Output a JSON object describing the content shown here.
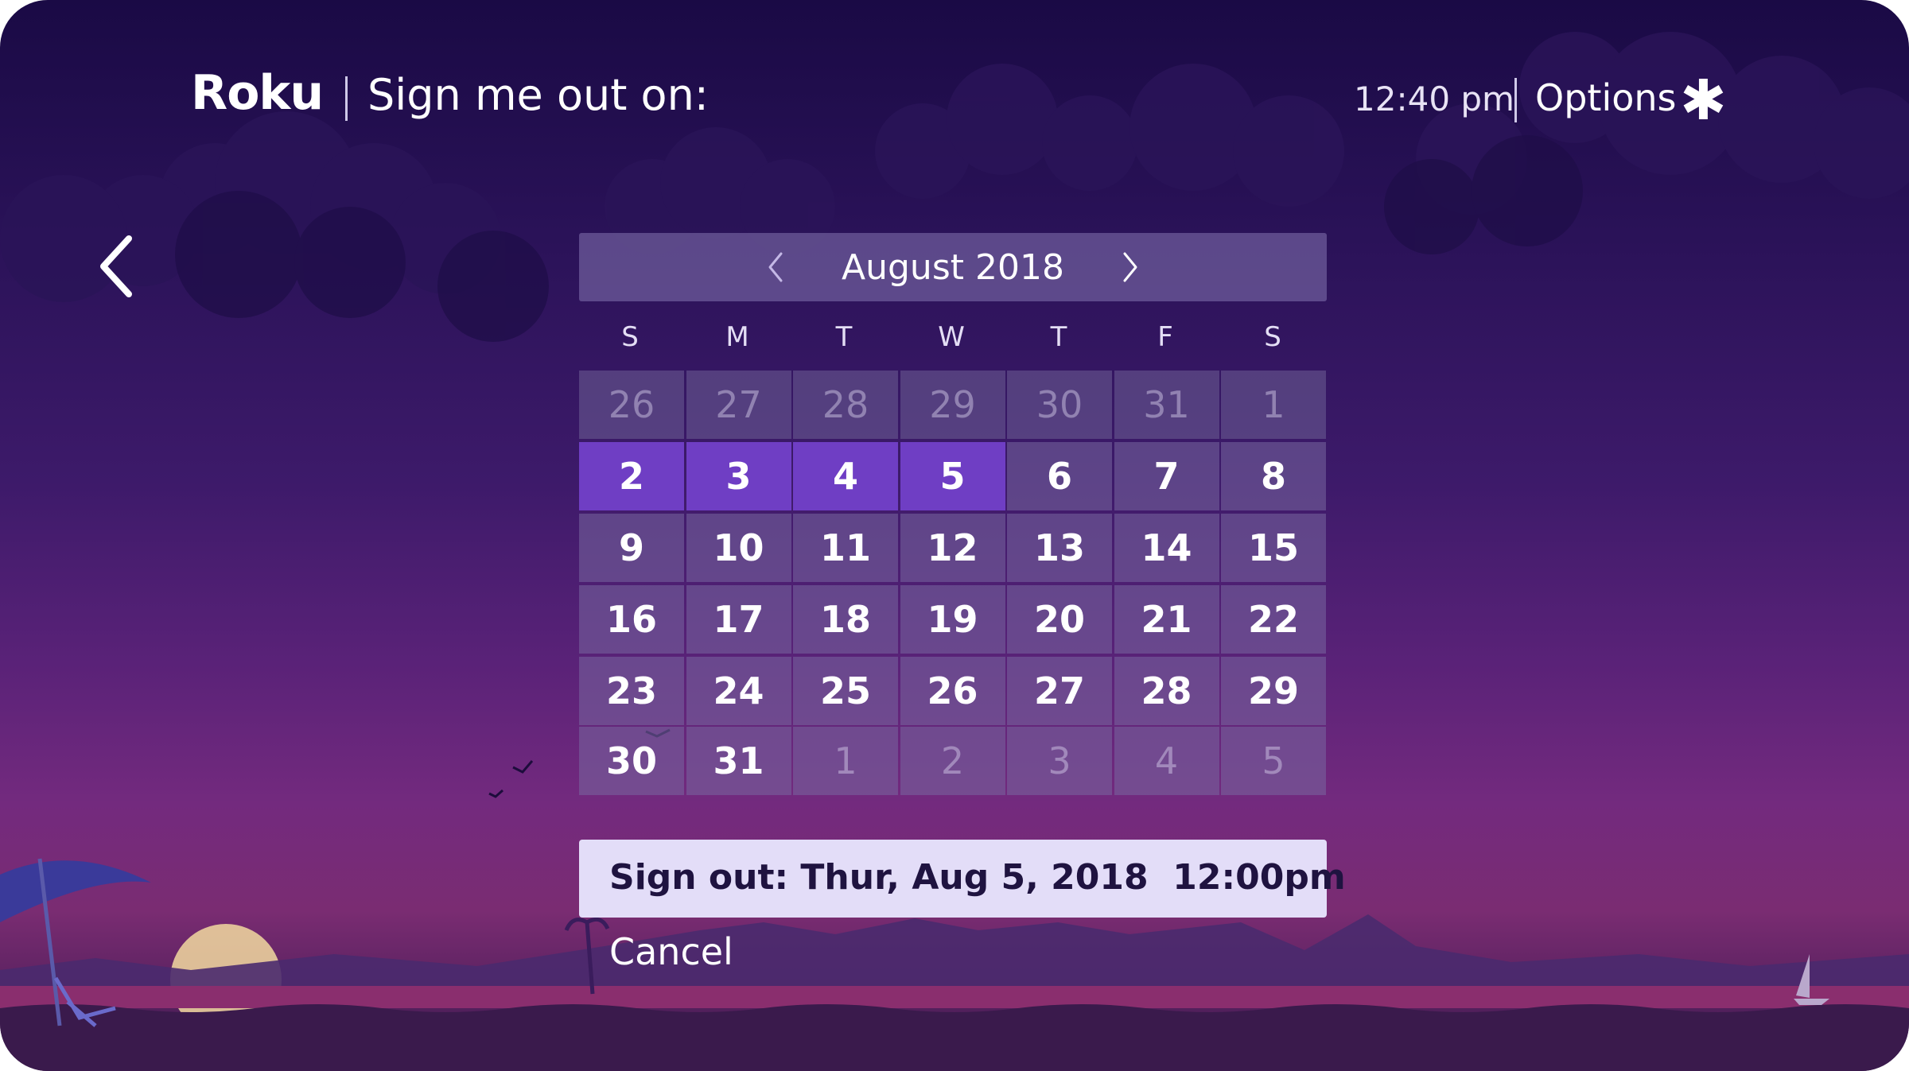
{
  "header": {
    "logo_text": "Roku",
    "title": "Sign me out on:",
    "time": "12:40 pm",
    "options_label": "Options",
    "options_icon": "star-icon"
  },
  "navigation": {
    "back_icon": "chevron-left-icon"
  },
  "calendar": {
    "month_label": "August 2018",
    "prev_icon": "chevron-left-icon",
    "next_icon": "chevron-right-icon",
    "weekdays": [
      "S",
      "M",
      "T",
      "W",
      "T",
      "F",
      "S"
    ],
    "weeks": [
      [
        {
          "day": "26",
          "in_month": false
        },
        {
          "day": "27",
          "in_month": false
        },
        {
          "day": "28",
          "in_month": false
        },
        {
          "day": "29",
          "in_month": false
        },
        {
          "day": "30",
          "in_month": false
        },
        {
          "day": "31",
          "in_month": false
        },
        {
          "day": "1",
          "in_month": false
        }
      ],
      [
        {
          "day": "2",
          "in_month": true,
          "selected": true
        },
        {
          "day": "3",
          "in_month": true,
          "selected": true
        },
        {
          "day": "4",
          "in_month": true,
          "selected": true
        },
        {
          "day": "5",
          "in_month": true,
          "selected": true
        },
        {
          "day": "6",
          "in_month": true
        },
        {
          "day": "7",
          "in_month": true
        },
        {
          "day": "8",
          "in_month": true
        }
      ],
      [
        {
          "day": "9",
          "in_month": true
        },
        {
          "day": "10",
          "in_month": true
        },
        {
          "day": "11",
          "in_month": true
        },
        {
          "day": "12",
          "in_month": true
        },
        {
          "day": "13",
          "in_month": true
        },
        {
          "day": "14",
          "in_month": true
        },
        {
          "day": "15",
          "in_month": true
        }
      ],
      [
        {
          "day": "16",
          "in_month": true
        },
        {
          "day": "17",
          "in_month": true
        },
        {
          "day": "18",
          "in_month": true
        },
        {
          "day": "19",
          "in_month": true
        },
        {
          "day": "20",
          "in_month": true
        },
        {
          "day": "21",
          "in_month": true
        },
        {
          "day": "22",
          "in_month": true
        }
      ],
      [
        {
          "day": "23",
          "in_month": true
        },
        {
          "day": "24",
          "in_month": true
        },
        {
          "day": "25",
          "in_month": true
        },
        {
          "day": "26",
          "in_month": true
        },
        {
          "day": "27",
          "in_month": true
        },
        {
          "day": "28",
          "in_month": true
        },
        {
          "day": "29",
          "in_month": true
        }
      ],
      [
        {
          "day": "30",
          "in_month": true
        },
        {
          "day": "31",
          "in_month": true
        },
        {
          "day": "1",
          "in_month": false
        },
        {
          "day": "2",
          "in_month": false
        },
        {
          "day": "3",
          "in_month": false
        },
        {
          "day": "4",
          "in_month": false
        },
        {
          "day": "5",
          "in_month": false
        }
      ]
    ]
  },
  "signout": {
    "label": "Sign out: Thur, Aug 5, 2018  12:00pm"
  },
  "cancel_label": "Cancel",
  "colors": {
    "selected_day": "#6f3ec4",
    "signout_bar": "#e3ddf8",
    "background_top": "#1a0a45",
    "background_bottom": "#732a7e"
  }
}
